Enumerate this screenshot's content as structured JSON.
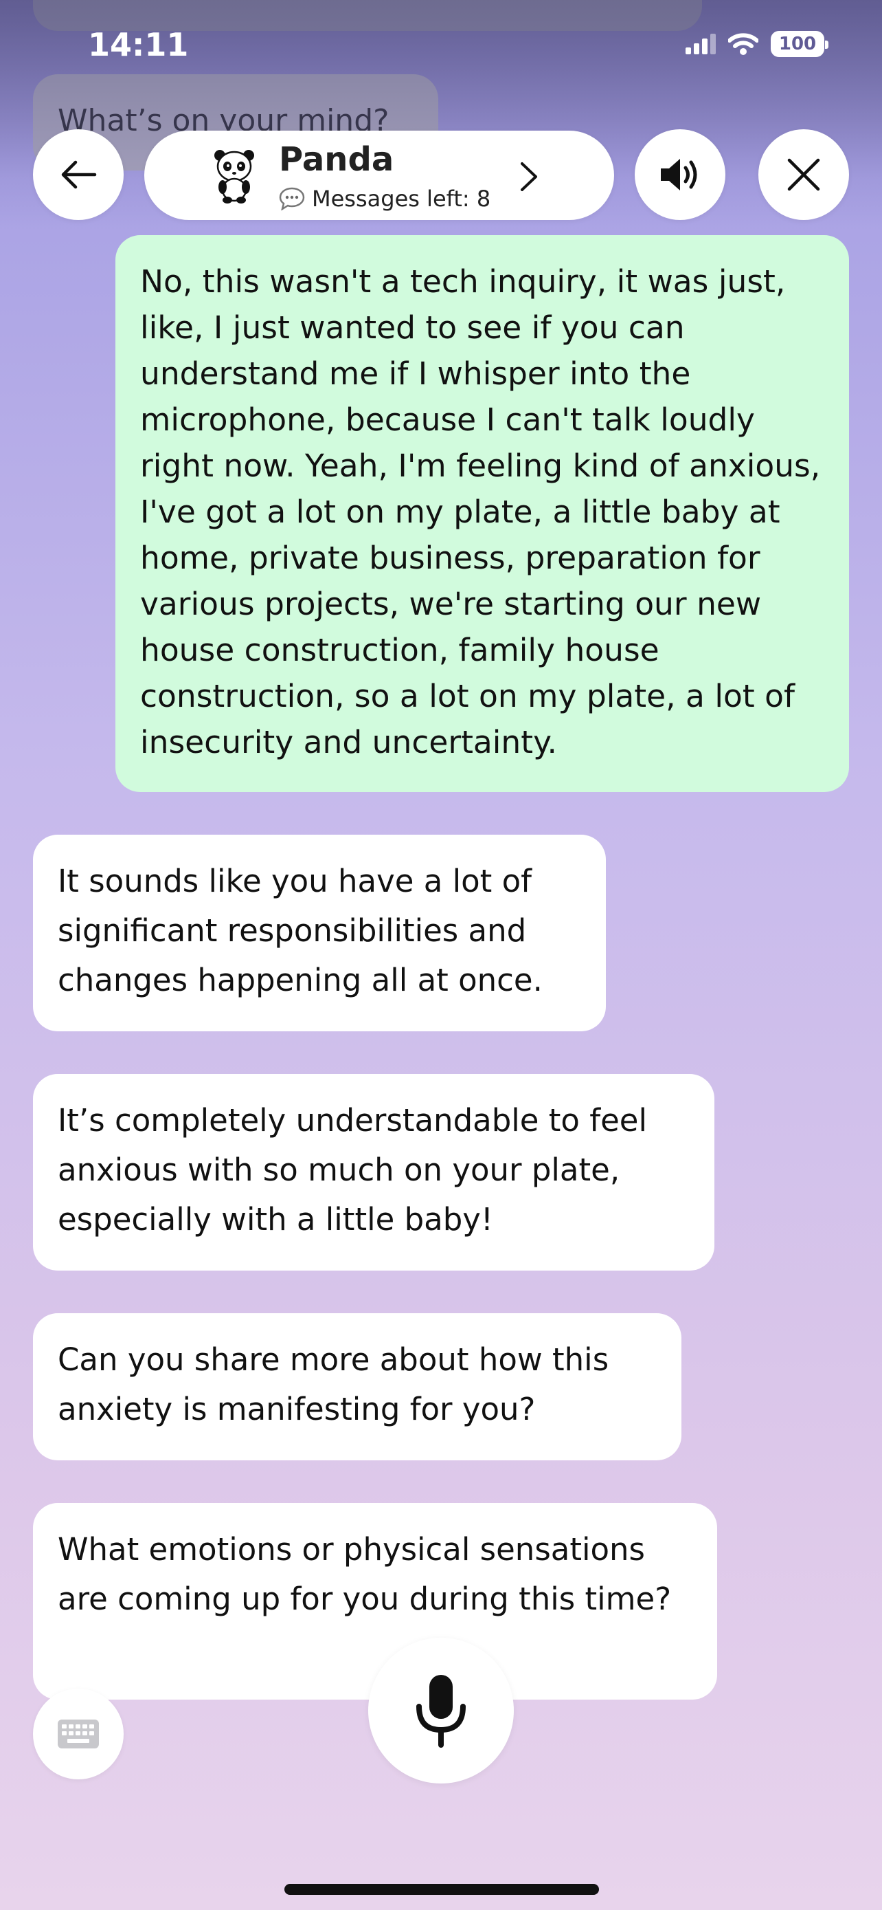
{
  "status_bar": {
    "time": "14:11",
    "battery": "100",
    "icons": [
      "cellular-signal-icon",
      "wifi-icon",
      "battery-icon"
    ]
  },
  "history": {
    "partial_message": "What’s on your mind?"
  },
  "header": {
    "agent_name": "Panda",
    "messages_left": "Messages left: 8",
    "icons": {
      "back": "arrow-left-icon",
      "avatar": "panda-icon",
      "messages": "chat-bubble-icon",
      "more": "chevron-right-icon",
      "sound": "speaker-icon",
      "close": "close-icon"
    }
  },
  "messages": [
    {
      "role": "user",
      "text": "No, this wasn't a tech inquiry, it was just, like, I just wanted to see if you can understand me if I whisper into the microphone, because I can't talk loudly right now. Yeah, I'm feeling kind of anxious, I've got a lot on my plate, a little baby at home, private business, preparation for various projects, we're starting our new house construction, family house construction, so a lot on my plate, a lot of insecurity and uncertainty."
    },
    {
      "role": "assistant",
      "text": "It sounds like you have a lot of significant responsibilities and changes happening all at once."
    },
    {
      "role": "assistant",
      "text": "It’s completely understandable to feel anxious with so much on your plate, especially with a little baby!"
    },
    {
      "role": "assistant",
      "text": "Can you share more about how this anxiety is manifesting for you?"
    },
    {
      "role": "assistant",
      "text": "What emotions or physical sensations are coming up for you during this time?"
    }
  ],
  "controls": {
    "keyboard_icon": "keyboard-icon",
    "mic_icon": "microphone-icon"
  },
  "colors": {
    "user_bubble": "#d1fbdd",
    "assistant_bubble": "#ffffff",
    "background_top": "#a9a2e4",
    "background_bottom": "#e8d4ec"
  }
}
